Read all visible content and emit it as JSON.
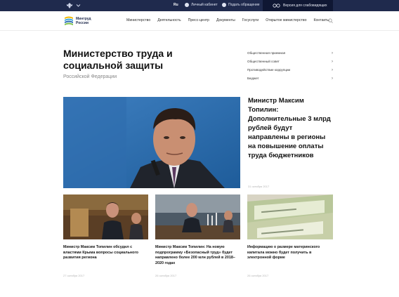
{
  "topbar": {
    "lang": "Ru",
    "cabinet": "Личный кабинет",
    "appeal": "Подать обращение",
    "blind_version": "Версия для слабовидящих"
  },
  "header": {
    "logo_text": "Минтруд России",
    "nav": [
      "Министерство",
      "Деятельность",
      "Пресс-центр",
      "Документы",
      "Госуслуги",
      "Открытое министерство",
      "Контакты"
    ]
  },
  "hero": {
    "title": "Министерство труда и социальной защиты",
    "subtitle": "Российской Федерации"
  },
  "quick_links": [
    "Общественная приемная",
    "Общественный совет",
    "Противодействие коррупции",
    "Бюджет"
  ],
  "featured": {
    "title": "Министр Максим Топилин: Дополнительные 3 млрд рублей будут направлены в регионы на повышение оплаты труда бюджетников",
    "date": "31 октября 2017"
  },
  "cards": [
    {
      "title": "Министр Максим Топилин обсудил с властями Крыма вопросы социального развития региона",
      "date": "27 октября 2017"
    },
    {
      "title": "Министр Максим Топилин: На новую подпрограмму «Безопасный труд» будет направлено более 200 млн рублей в 2018–2020 годах",
      "date": "26 октября 2017"
    },
    {
      "title": "Информацию о размере материнского капитала можно будет получить в электронной форме",
      "date": "26 октября 2017"
    }
  ]
}
